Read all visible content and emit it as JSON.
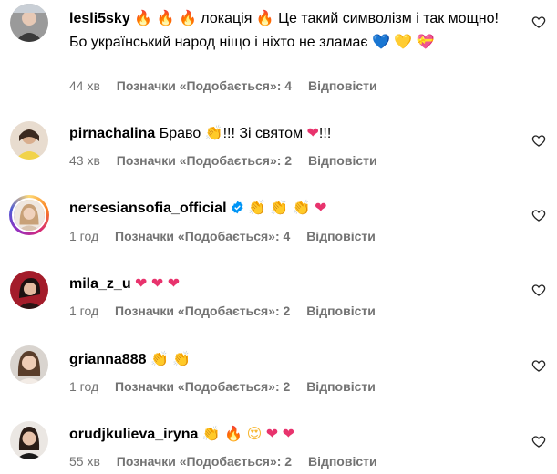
{
  "comments": [
    {
      "username": "lesli5sky",
      "segments": [
        "🔥",
        " ",
        "🔥",
        " ",
        "🔥",
        " локація ",
        "🔥",
        " Це такий символізм і так мощно! Бо український народ ніщо і ніхто не зламає ",
        "💙",
        " ",
        "💛",
        " ",
        "💝"
      ],
      "time": "44 хв",
      "likes": "Позначки «Подобається»: 4",
      "reply": "Відповісти"
    },
    {
      "username": "pirnachalina",
      "segments": [
        "Браво ",
        "👏",
        "!!! Зі святом ",
        "❤",
        "!!!"
      ],
      "time": "43 хв",
      "likes": "Позначки «Подобається»: 2",
      "reply": "Відповісти"
    },
    {
      "username": "nersesiansofia_official",
      "verified": true,
      "segments": [
        "👏",
        " ",
        "👏",
        " ",
        "👏",
        " ",
        "❤"
      ],
      "time": "1 год",
      "likes": "Позначки «Подобається»: 4",
      "reply": "Відповісти"
    },
    {
      "username": "mila_z_u",
      "segments": [
        "❤",
        " ",
        "❤",
        " ",
        "❤"
      ],
      "time": "1 год",
      "likes": "Позначки «Подобається»: 2",
      "reply": "Відповісти"
    },
    {
      "username": "grianna888",
      "segments": [
        "👏",
        " ",
        "👏"
      ],
      "time": "1 год",
      "likes": "Позначки «Подобається»: 2",
      "reply": "Відповісти"
    },
    {
      "username": "orudjkulieva_iryna",
      "segments": [
        "👏",
        " ",
        "🔥",
        " ",
        "😍",
        " ",
        "❤",
        " ",
        "❤"
      ],
      "time": "55 хв",
      "likes": "Позначки «Подобається»: 2",
      "reply": "Відповісти"
    }
  ],
  "icons": {
    "like": "heart-outline-icon",
    "verified": "verified-badge-icon"
  },
  "colors": {
    "meta": "#737373",
    "verified": "#0095f6"
  }
}
